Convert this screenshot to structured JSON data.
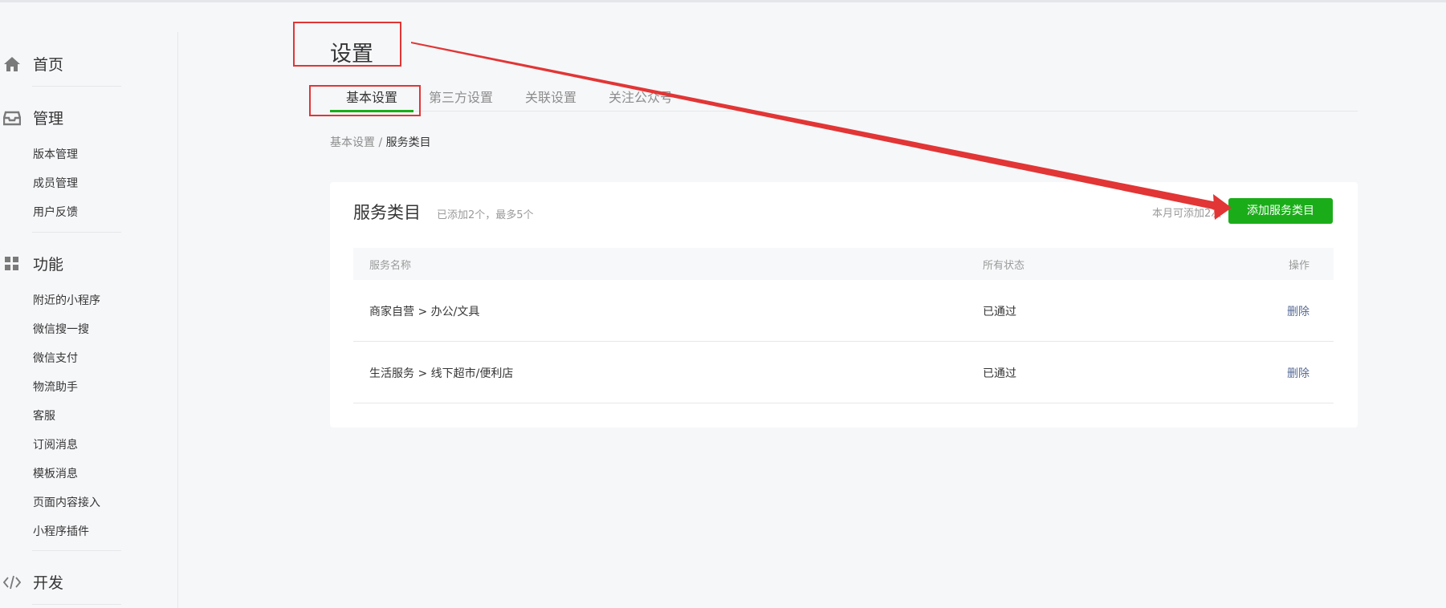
{
  "sidebar": {
    "sections": [
      {
        "label": "首页",
        "icon": "home-icon"
      },
      {
        "label": "管理",
        "icon": "inbox-icon",
        "items": [
          "版本管理",
          "成员管理",
          "用户反馈"
        ]
      },
      {
        "label": "功能",
        "icon": "grid-icon",
        "items": [
          "附近的小程序",
          "微信搜一搜",
          "微信支付",
          "物流助手",
          "客服",
          "订阅消息",
          "模板消息",
          "页面内容接入",
          "小程序插件"
        ]
      },
      {
        "label": "开发",
        "icon": "code-icon"
      }
    ]
  },
  "page": {
    "title": "设置",
    "tabs": [
      "基本设置",
      "第三方设置",
      "关联设置",
      "关注公众号"
    ],
    "active_tab": "基本设置",
    "breadcrumb": {
      "parent": "基本设置",
      "separator": " / ",
      "current": "服务类目"
    }
  },
  "card": {
    "title": "服务类目",
    "subtitle": "已添加2个，最多5个",
    "monthly_note": "本月可添加2次",
    "add_button": "添加服务类目",
    "columns": [
      "服务名称",
      "所有状态",
      "操作"
    ],
    "rows": [
      {
        "name": "商家自营  >  办公/文具",
        "status": "已通过",
        "action": "删除"
      },
      {
        "name": "生活服务  >  线下超市/便利店",
        "status": "已通过",
        "action": "删除"
      }
    ]
  },
  "colors": {
    "accent": "#1aad19",
    "annotation": "#e23535",
    "link": "#576b95"
  }
}
